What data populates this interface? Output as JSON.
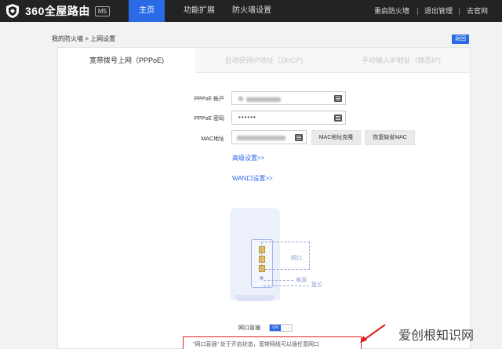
{
  "header": {
    "logo_text": "360全屋路由",
    "model": "M5",
    "tabs": [
      "主页",
      "功能扩展",
      "防火墙设置"
    ],
    "right_links": [
      "重启防火墙",
      "退出管理",
      "去官网"
    ]
  },
  "breadcrumb": "我的防火墙 > 上网设置",
  "back_label": "返回",
  "conn_tabs": [
    "宽带拨号上网（PPPoE)",
    "自动获得IP地址（DHCP)",
    "手动输入IP地址（静态IP)"
  ],
  "form": {
    "account_label": "PPPoE 帐户",
    "password_label": "PPPoE 密码",
    "password_value": "••••••",
    "mac_label": "MAC地址",
    "mac_clone_label": "MAC地址克隆",
    "mac_restore_label": "恢复缺省MAC",
    "advanced_link": "高级设置>>",
    "wan_link": "WAN口设置>>"
  },
  "illustration": {
    "port_label": "网口",
    "power_label": "电源",
    "reset_label": "复位"
  },
  "toggle": {
    "label": "网口盲插",
    "state": "ON"
  },
  "notice": "\"网口盲插\" 处于开启状态，宽带网线可以插任意网口",
  "watermark": "爱创根知识网",
  "colors": {
    "accent": "#2b6ae6",
    "nav_bg": "#232323",
    "highlight": "#e02020"
  }
}
